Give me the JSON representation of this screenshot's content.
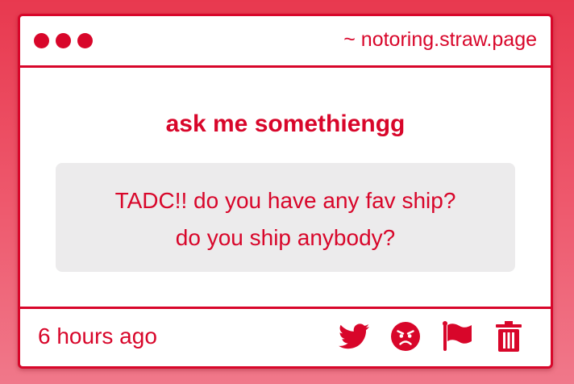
{
  "window": {
    "url": "~ notoring.straw.page",
    "dots": [
      "dot-1",
      "dot-2",
      "dot-3"
    ]
  },
  "main": {
    "prompt": "ask me somethiengg",
    "question_lines": [
      "TADC!! do you have any fav ship?",
      "do you ship anybody?"
    ]
  },
  "footer": {
    "timestamp": "6 hours ago",
    "actions": [
      {
        "name": "twitter-share-button",
        "icon": "twitter-bird-icon"
      },
      {
        "name": "react-button",
        "icon": "angry-face-icon"
      },
      {
        "name": "report-button",
        "icon": "flag-icon"
      },
      {
        "name": "delete-button",
        "icon": "trash-icon"
      }
    ]
  },
  "colors": {
    "accent": "#d8062a",
    "question_bg": "#ecebec",
    "page_bg_top": "#e8394f",
    "page_bg_bottom": "#f0788a"
  }
}
